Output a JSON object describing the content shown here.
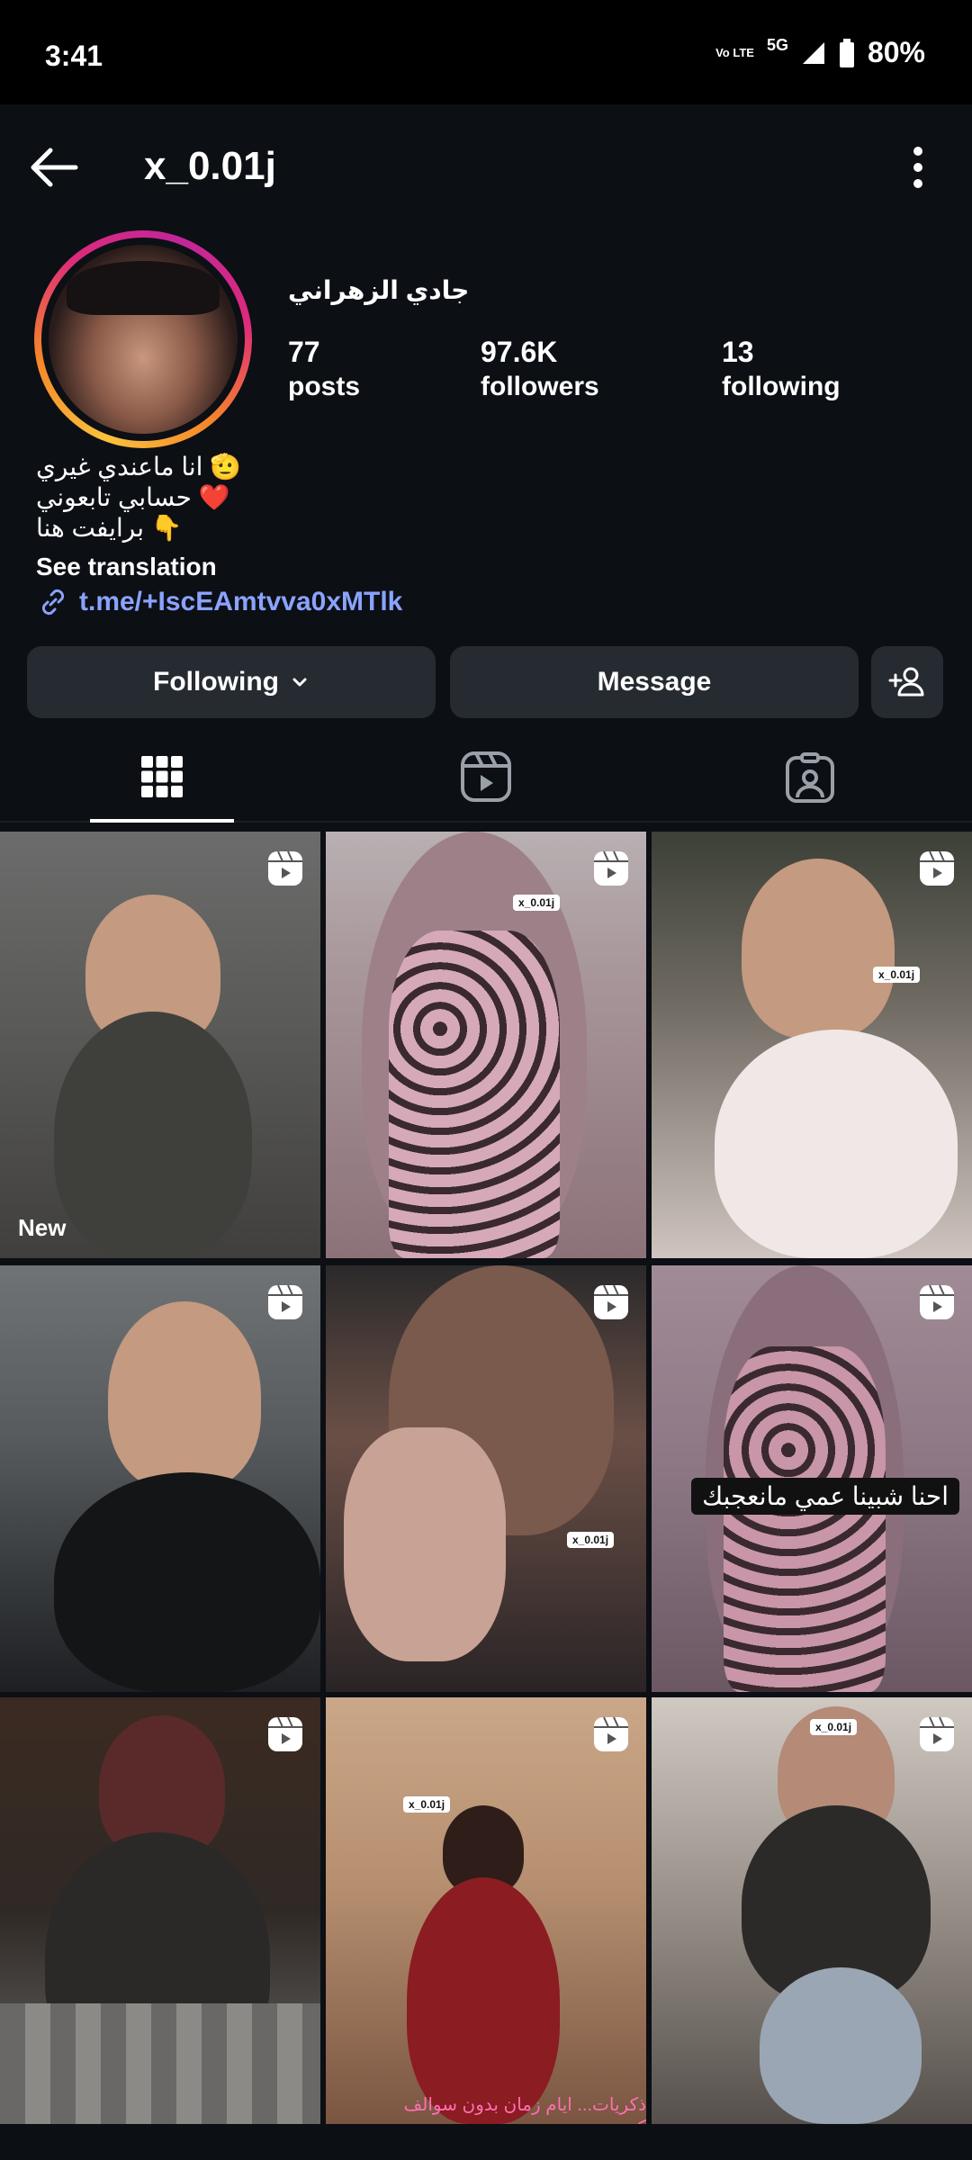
{
  "status_bar": {
    "time": "3:41",
    "volte": "Vo LTE",
    "network": "5G",
    "battery": "80%"
  },
  "header": {
    "username": "x_0.01j",
    "icons": [
      "back-arrow-icon",
      "more-vertical-icon"
    ]
  },
  "profile": {
    "display_name": "جادي الزهراني",
    "stats": [
      {
        "value": "77",
        "label": "posts"
      },
      {
        "value": "97.6K",
        "label": "followers"
      },
      {
        "value": "13",
        "label": "following"
      }
    ],
    "bio_lines": [
      "انا ماعندي غيري 🫡",
      "حسابي تابعوني ❤️",
      "برايفت هنا 👇"
    ],
    "see_translation": "See translation",
    "link": "t.me/+IscEAmtvva0xMTlk"
  },
  "actions": {
    "following_label": "Following",
    "message_label": "Message"
  },
  "tabs": [
    "posts-grid-icon",
    "reels-icon",
    "tagged-icon"
  ],
  "grid": {
    "new_label": "New",
    "captions": {
      "c6": "احنا شبينا عمي مانعجبك",
      "c8": "ذكريات... ايام زمان بدون سوالف كنت"
    },
    "watermarks": {
      "c2": "x_0.01j",
      "c3": "x_0.01j",
      "c5": "x_0.01j",
      "c8": "x_0.01j",
      "c9": "x_0.01j"
    }
  },
  "colors": {
    "background": "#0c0f14",
    "button_bg": "#262a31",
    "link": "#8aa3ff"
  }
}
